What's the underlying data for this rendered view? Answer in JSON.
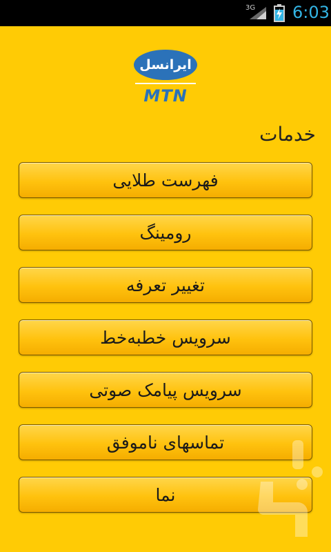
{
  "status_bar": {
    "network": "3G",
    "time": "6:03"
  },
  "logo": {
    "brand_fa": "ایرانسل",
    "brand_en": "MTN"
  },
  "section": {
    "title": "خدمات"
  },
  "menu": [
    {
      "label": "فهرست طلایی"
    },
    {
      "label": "رومینگ"
    },
    {
      "label": "تغییر تعرفه"
    },
    {
      "label": "سرویس خطبه‌خط"
    },
    {
      "label": "سرویس پیامک صوتی"
    },
    {
      "label": "تماسهای ناموفق"
    },
    {
      "label": "نما"
    }
  ],
  "colors": {
    "background": "#ffcb05",
    "brand_blue": "#2b72b9",
    "status_accent": "#33b5e5"
  }
}
